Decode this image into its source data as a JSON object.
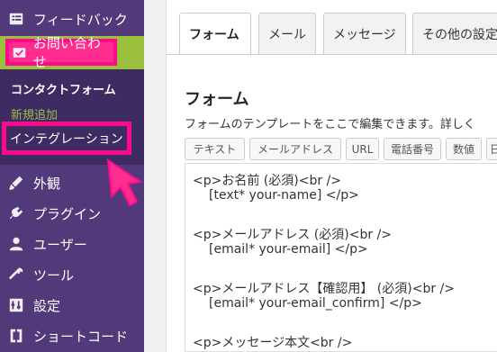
{
  "sidebar": {
    "feedback": "フィードバック",
    "contact": "お問い合わせ",
    "submenu": {
      "contact_form": "コンタクトフォーム",
      "new": "新規追加",
      "integration": "インテグレーション"
    },
    "appearance": "外観",
    "plugins": "プラグイン",
    "users": "ユーザー",
    "tools": "ツール",
    "settings": "設定",
    "shortcode": "ショートコード"
  },
  "colors": {
    "sidebar_bg": "#523a7a",
    "submenu_bg": "#3e2b62",
    "active_bg": "#9ac03e",
    "highlight": "#ff0a8c"
  },
  "tabs": {
    "form": "フォーム",
    "mail": "メール",
    "message": "メッセージ",
    "other": "その他の設定"
  },
  "main": {
    "title": "フォーム",
    "description": "フォームのテンプレートをここで編集できます。詳しく"
  },
  "tag_buttons": {
    "text": "テキスト",
    "email": "メールアドレス",
    "url": "URL",
    "tel": "電話番号",
    "number": "数値",
    "more": "日"
  },
  "editor": {
    "lines": [
      "<p>お名前 (必須)<br />",
      "[text* your-name] </p>",
      "<p>メールアドレス (必須)<br />",
      "[email* your-email] </p>",
      "<p>メールアドレス【確認用】 (必須)<br />",
      "[email* your-email_confirm] </p>",
      "<p>メッセージ本文<br />"
    ]
  }
}
